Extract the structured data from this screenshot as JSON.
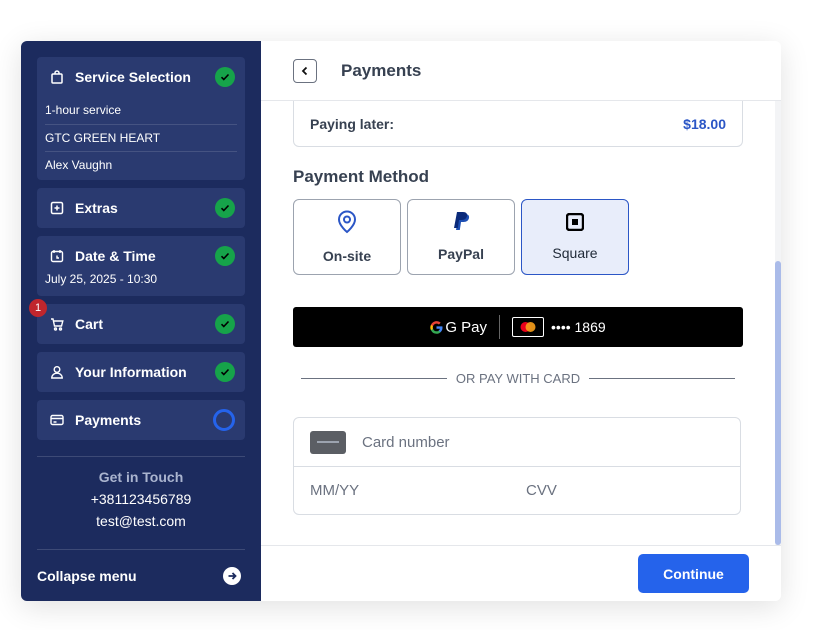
{
  "sidebar": {
    "steps": [
      {
        "title": "Service Selection",
        "details": [
          "1-hour service",
          "GTC GREEN HEART",
          "Alex Vaughn"
        ],
        "status": "done"
      },
      {
        "title": "Extras",
        "status": "done"
      },
      {
        "title": "Date & Time",
        "detail": "July 25, 2025 - 10:30",
        "status": "done"
      },
      {
        "title": "Cart",
        "badge": "1",
        "status": "done"
      },
      {
        "title": "Your Information",
        "status": "done"
      },
      {
        "title": "Payments",
        "status": "current"
      }
    ],
    "contact": {
      "heading": "Get in Touch",
      "phone": "+381123456789",
      "email": "test@test.com"
    },
    "collapse_label": "Collapse menu"
  },
  "header": {
    "title": "Payments"
  },
  "summary": {
    "label": "Paying later:",
    "amount": "$18.00"
  },
  "payment_method": {
    "title": "Payment Method",
    "options": [
      {
        "label": "On-site",
        "icon": "location-pin-icon"
      },
      {
        "label": "PayPal",
        "icon": "paypal-icon"
      },
      {
        "label": "Square",
        "icon": "square-icon",
        "selected": true
      }
    ]
  },
  "gpay": {
    "brand": "G Pay",
    "card": "•••• 1869"
  },
  "divider_text": "OR PAY WITH CARD",
  "card_form": {
    "card_number_placeholder": "Card number",
    "expiry_placeholder": "MM/YY",
    "cvv_placeholder": "CVV"
  },
  "footer": {
    "continue_label": "Continue"
  },
  "colors": {
    "sidebar": "#1c2b5e",
    "accent": "#2563eb",
    "success": "#16a34a",
    "badge": "#c0262d"
  }
}
